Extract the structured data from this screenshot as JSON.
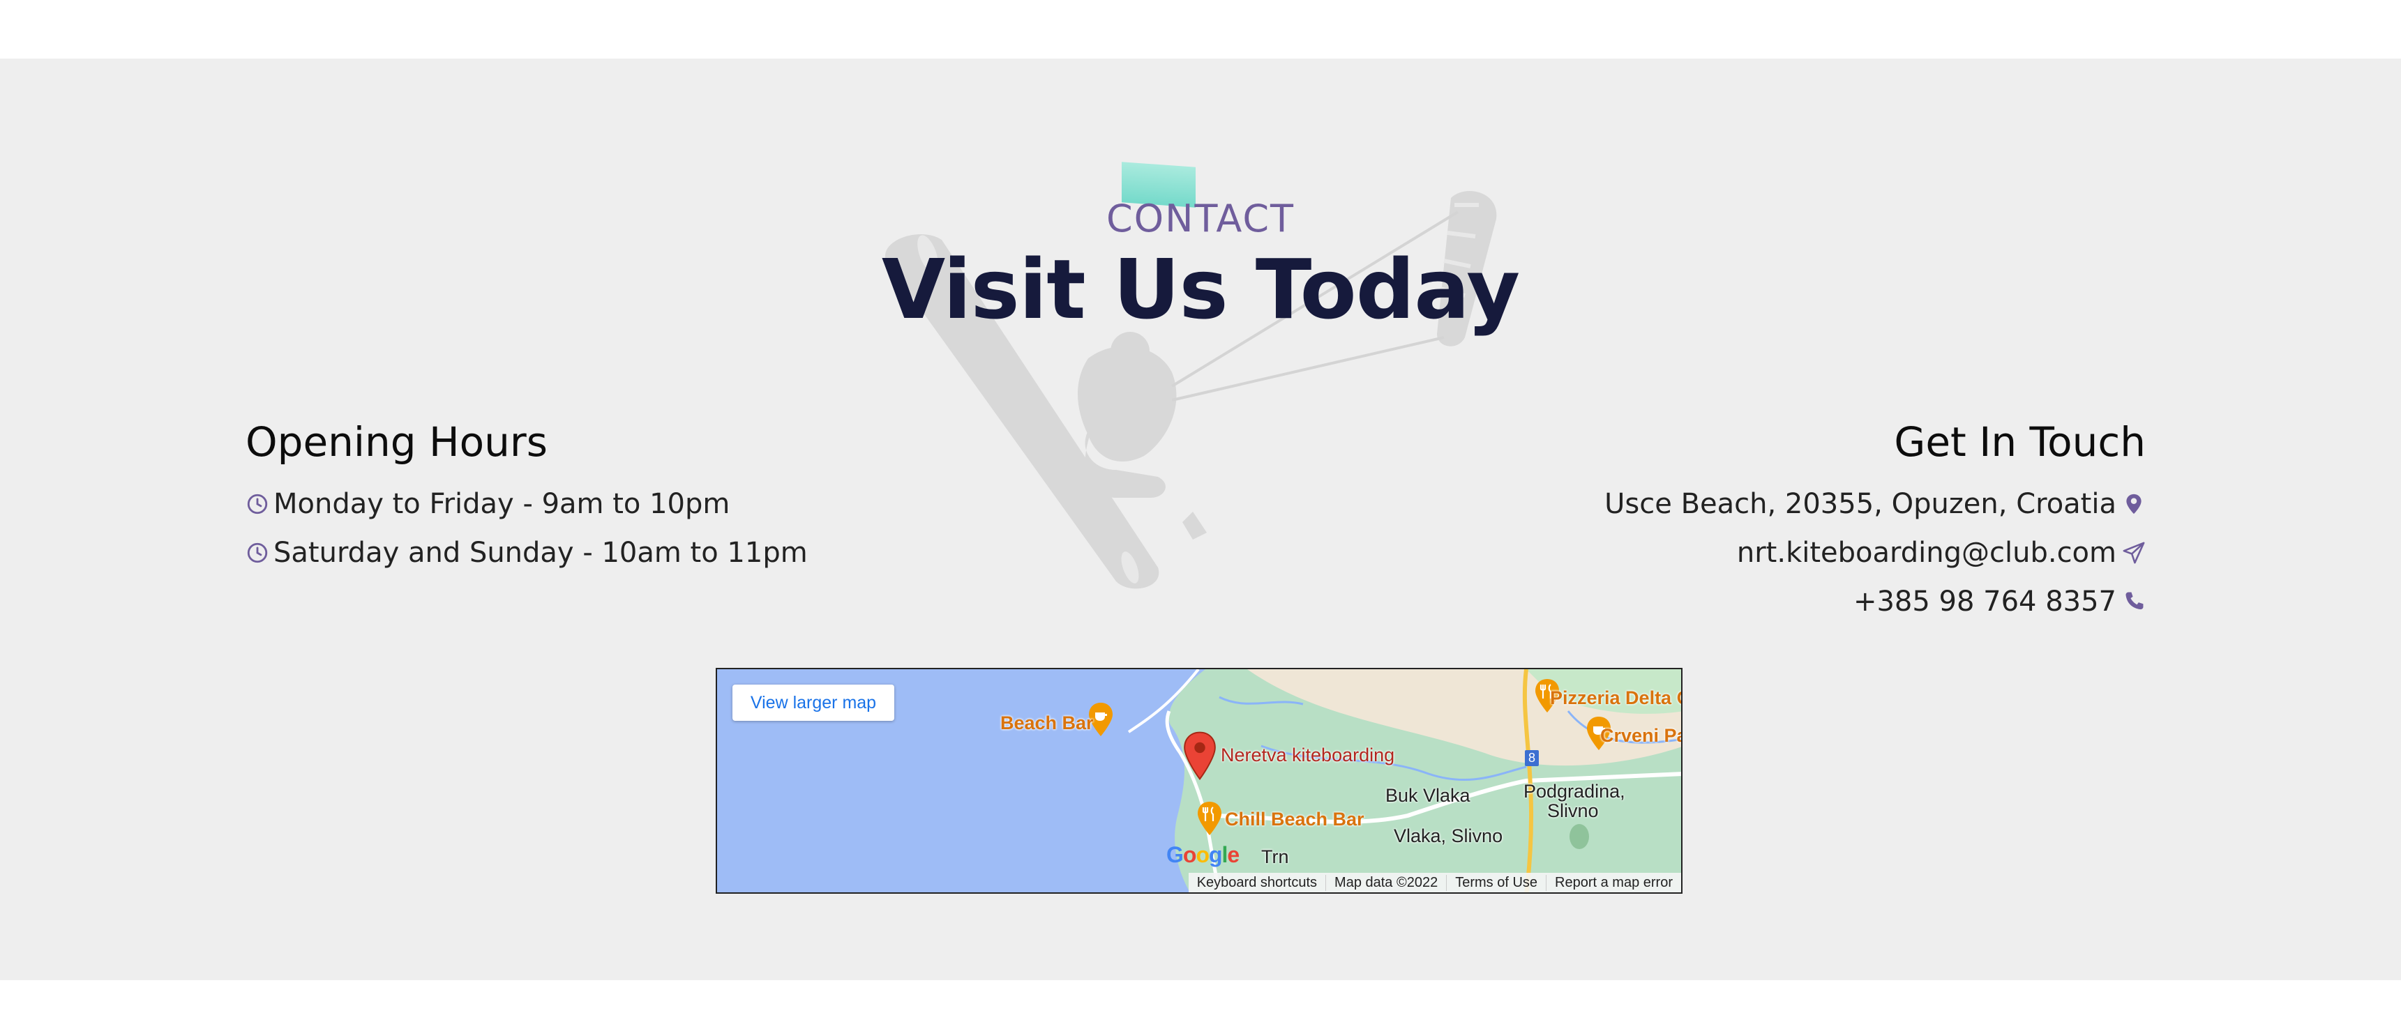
{
  "contact": {
    "eyebrow": "CONTACT",
    "title": "Visit Us Today"
  },
  "opening_hours": {
    "title": "Opening Hours",
    "items": [
      {
        "icon": "clock-icon",
        "text": "Monday to Friday - 9am to 10pm"
      },
      {
        "icon": "clock-icon",
        "text": "Saturday and Sunday - 10am to 11pm"
      }
    ]
  },
  "get_in_touch": {
    "title": "Get In Touch",
    "address": {
      "icon": "map-pin-icon",
      "text": "Usce Beach, 20355, Opuzen, Croatia"
    },
    "email": {
      "icon": "paper-plane-icon",
      "text": "nrt.kiteboarding@club.com"
    },
    "phone": {
      "icon": "phone-icon",
      "text": "+385 98 764 8357"
    }
  },
  "map": {
    "larger_map_button": "View larger map",
    "labels": {
      "beach_bar": "Beach Bar",
      "neretva": "Neretva kiteboarding",
      "chill_beach_bar": "Chill Beach Bar",
      "pizzeria": "Pizzeria Delta O",
      "crveni": "Crveni Pa",
      "buk_vlaka": "Buk Vlaka",
      "podgradina": "Podgradina,",
      "slivno": "Slivno",
      "vlaka_slivno": "Vlaka, Slivno",
      "trn": "Trn",
      "route_number": "8"
    },
    "footer": {
      "keyboard": "Keyboard shortcuts",
      "map_data": "Map data ©2022",
      "terms": "Terms of Use",
      "report": "Report a map error"
    }
  },
  "colors": {
    "accent_purple": "#6f5d9c",
    "title_navy": "#161a3c",
    "teal_mark": "#5fd6c4",
    "section_bg": "#eeeeee"
  }
}
